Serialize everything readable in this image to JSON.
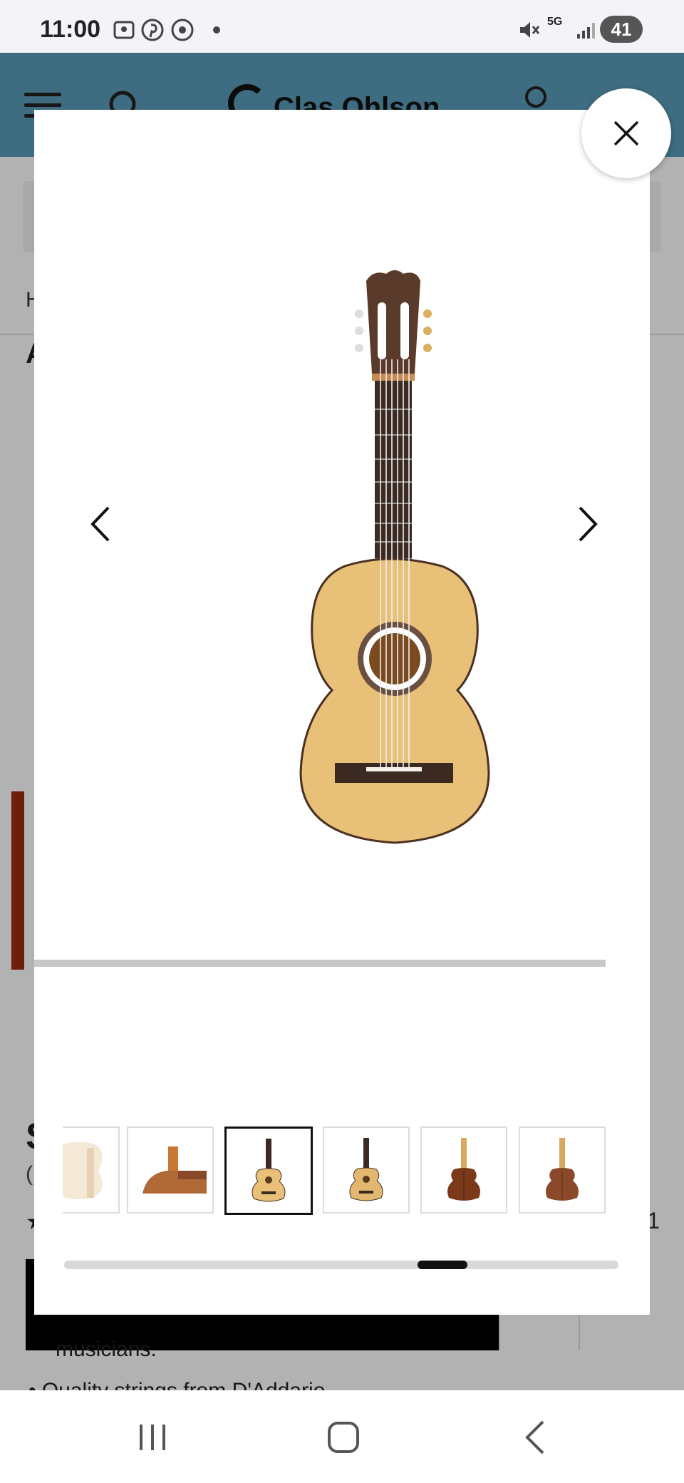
{
  "status_bar": {
    "time": "11:00",
    "battery": "41",
    "network": "5G",
    "icons": [
      "screenshot-icon",
      "pinterest-icon",
      "chrome-icon",
      "dot-icon",
      "mute-icon",
      "5g-icon",
      "signal-icon",
      "battery-icon"
    ]
  },
  "background_page": {
    "brand": "Clas Ohlson",
    "breadcrumb_initial": "H",
    "title_initial": "A",
    "heading_initial": "S",
    "paren_text": "(",
    "rating_star": "★",
    "rating_tail": "1",
    "text_line_1": "musicians.",
    "text_line_2": "• Quality strings from D'Addario"
  },
  "modal": {
    "close_icon": "close-icon",
    "prev_icon": "chevron-left-icon",
    "next_icon": "chevron-right-icon",
    "main_image": "classical-guitar-front",
    "active_thumbnail_index": 2,
    "thumbnail_scroll_position": 0.68,
    "thumbnails": [
      {
        "name": "guitar-body-detail"
      },
      {
        "name": "guitar-side-closeup"
      },
      {
        "name": "guitar-front-light"
      },
      {
        "name": "guitar-front-light-alt"
      },
      {
        "name": "guitar-back-dark"
      },
      {
        "name": "guitar-back-brown"
      }
    ]
  },
  "colors": {
    "header": "#5a9bb8",
    "spruce_top": "#e8c078",
    "fretboard": "#3a2a22",
    "back_wood": "#8a4a2a"
  },
  "nav_bar": {
    "icons": [
      "recent-apps-icon",
      "home-icon",
      "back-icon"
    ]
  }
}
